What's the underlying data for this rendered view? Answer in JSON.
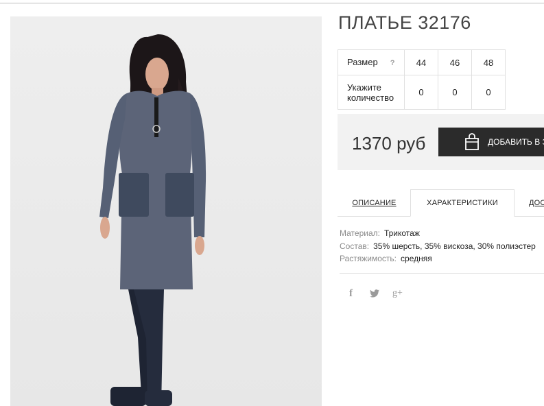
{
  "product": {
    "title": "ПЛАТЬЕ 32176",
    "image_alt": "product-photo"
  },
  "sizes": {
    "row_label": "Размер",
    "help": "?",
    "values": [
      "44",
      "46",
      "48"
    ],
    "qty_label": "Укажите количество",
    "quantities": [
      "0",
      "0",
      "0"
    ]
  },
  "purchase": {
    "price": "1370 руб",
    "add_button": "ДОБАВИТЬ В З"
  },
  "tabs": [
    {
      "label": "ОПИСАНИЕ"
    },
    {
      "label": "ХАРАКТЕРИСТИКИ"
    },
    {
      "label": "ДОС"
    }
  ],
  "properties": [
    {
      "key": "Материал:",
      "value": "Трикотаж"
    },
    {
      "key": "Состав:",
      "value": "35% шерсть, 35% вискоза, 30% полиэстер"
    },
    {
      "key": "Растяжимость:",
      "value": "средняя"
    }
  ],
  "social": {
    "facebook": "f",
    "twitter_icon": "twitter-icon",
    "google_plus": "g+"
  },
  "colors": {
    "button_bg": "#2b2b2b",
    "price_bar_bg": "#f2f2f2",
    "dress": "#5c6478"
  }
}
